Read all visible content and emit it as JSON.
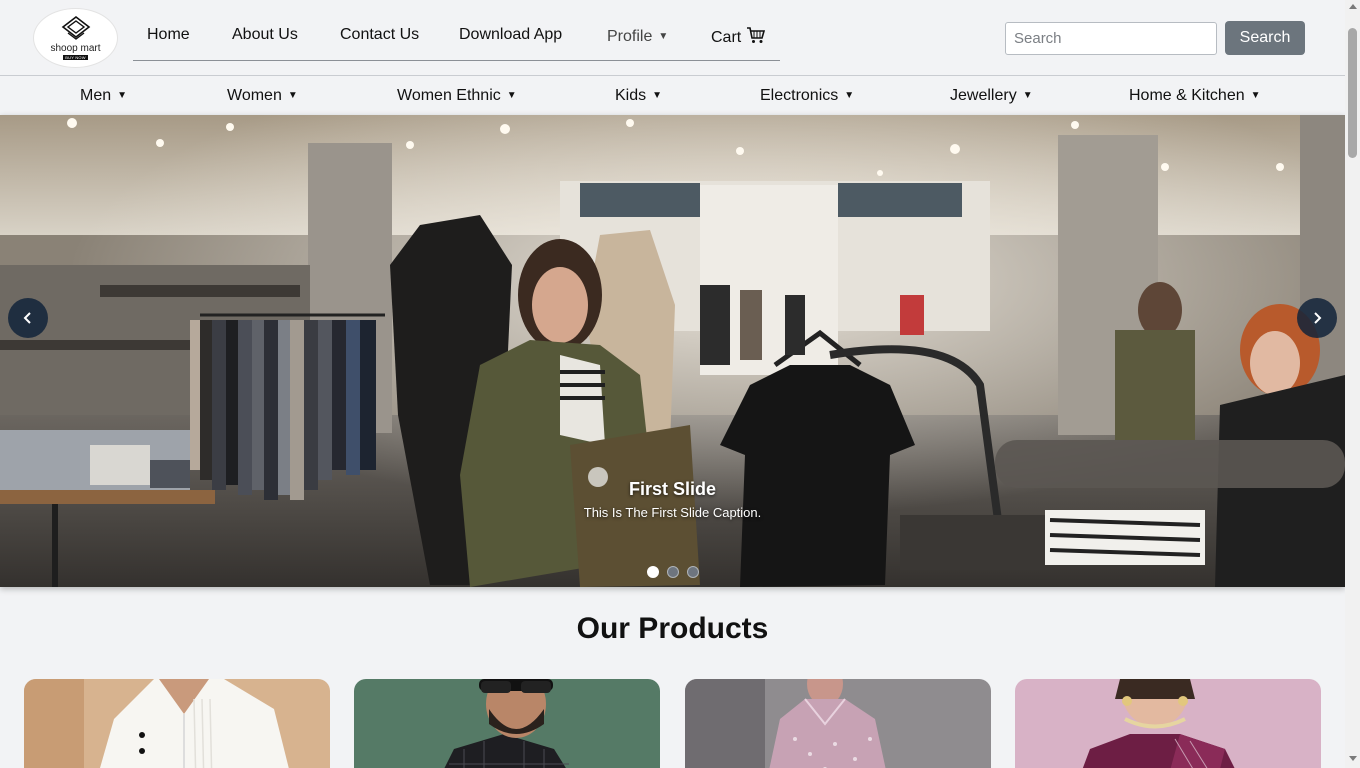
{
  "brand": {
    "name": "shoop mart",
    "tagline": "BUY NOW"
  },
  "nav": {
    "home": "Home",
    "about": "About Us",
    "contact": "Contact Us",
    "download": "Download App",
    "profile": "Profile",
    "cart": "Cart"
  },
  "search": {
    "placeholder": "Search",
    "button": "Search"
  },
  "categories": [
    "Men",
    "Women",
    "Women Ethnic",
    "Kids",
    "Electronics",
    "Jewellery",
    "Home & Kitchen"
  ],
  "carousel": {
    "title": "First Slide",
    "caption": "This Is The First Slide Caption.",
    "slides": 3,
    "active_slide": 1
  },
  "products": {
    "heading": "Our Products",
    "count_visible": 4
  },
  "colors": {
    "accent": "#6c757d",
    "arrow": "#12233a",
    "background": "#f2f3f5"
  }
}
